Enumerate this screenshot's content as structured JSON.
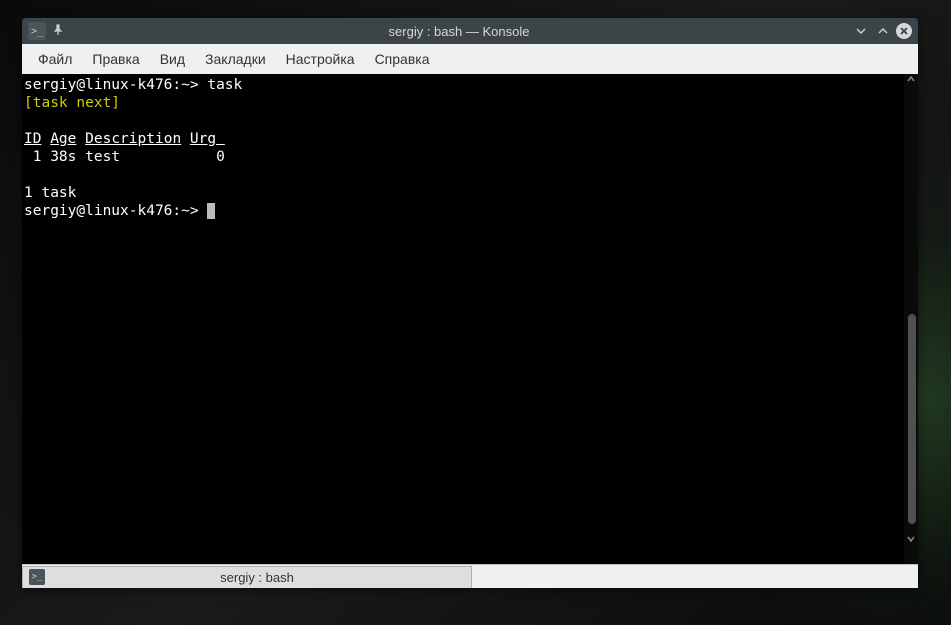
{
  "window": {
    "title": "sergiy : bash — Konsole"
  },
  "menubar": {
    "items": [
      "Файл",
      "Правка",
      "Вид",
      "Закладки",
      "Настройка",
      "Справка"
    ]
  },
  "terminal": {
    "line1": {
      "prompt": "sergiy@linux-k476:~>",
      "command": " task"
    },
    "line2": "[task next]",
    "headers": {
      "id": "ID",
      "age": "Age",
      "desc": "Description",
      "urg": "Urg "
    },
    "row": {
      "id": " 1",
      "age": "38s",
      "desc": "test       ",
      "urg": "   0"
    },
    "summary": "1 task",
    "prompt2": "sergiy@linux-k476:~> "
  },
  "tab": {
    "label": "sergiy : bash"
  }
}
